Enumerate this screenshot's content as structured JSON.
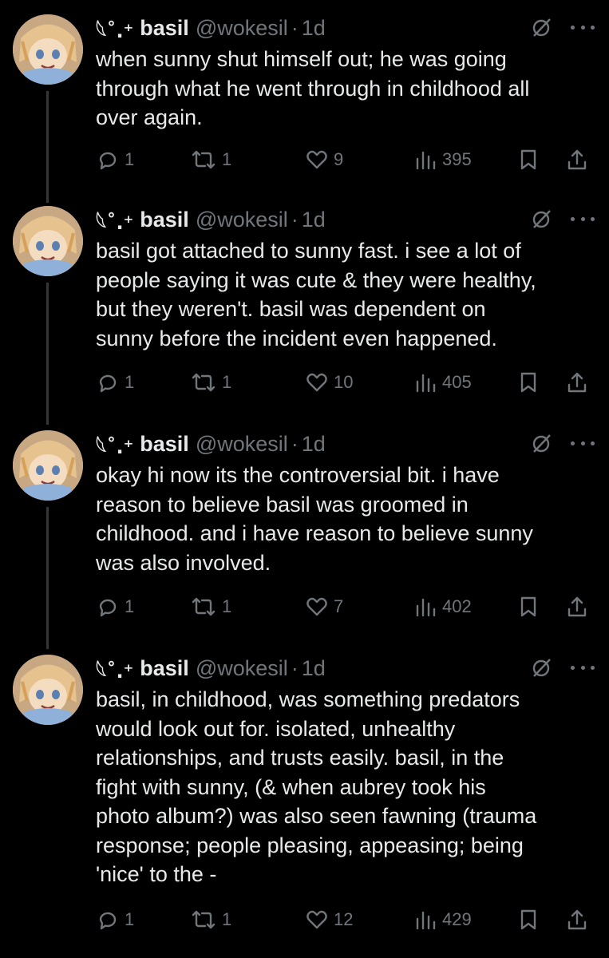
{
  "tweets": [
    {
      "deco": "𓆩˚.⁺",
      "name": "basil",
      "handle": "@wokesil",
      "dot": "·",
      "time": "1d",
      "text": "when sunny shut himself out; he was going\nthrough what he went through in childhood all\nover again.",
      "replies": "1",
      "retweets": "1",
      "likes": "9",
      "views": "395"
    },
    {
      "deco": "𓆩˚.⁺",
      "name": "basil",
      "handle": "@wokesil",
      "dot": "·",
      "time": "1d",
      "text": "basil got attached to sunny fast. i see a lot of\npeople saying it was cute & they were healthy,\nbut they weren't. basil was dependent on\nsunny before the incident even happened.",
      "replies": "1",
      "retweets": "1",
      "likes": "10",
      "views": "405"
    },
    {
      "deco": "𓆩˚.⁺",
      "name": "basil",
      "handle": "@wokesil",
      "dot": "·",
      "time": "1d",
      "text": "okay hi now its the controversial bit. i have\nreason to believe basil was groomed in\nchildhood. and i have reason to believe sunny\nwas also involved.",
      "replies": "1",
      "retweets": "1",
      "likes": "7",
      "views": "402"
    },
    {
      "deco": "𓆩˚.⁺",
      "name": "basil",
      "handle": "@wokesil",
      "dot": "·",
      "time": "1d",
      "text": "basil, in childhood, was something predators\nwould look out for. isolated, unhealthy\nrelationships, and trusts easily. basil, in the\nfight with sunny, (& when aubrey took his\nphoto album?) was also seen fawning (trauma\nresponse; people pleasing, appeasing; being\n'nice' to the -",
      "replies": "1",
      "retweets": "1",
      "likes": "12",
      "views": "429"
    }
  ],
  "colors": {
    "background": "#000000",
    "text": "#e7e9ea",
    "muted": "#71767b",
    "thread_line": "#333639"
  },
  "icons": [
    "reply-icon",
    "retweet-icon",
    "like-icon",
    "views-icon",
    "bookmark-icon",
    "share-icon",
    "grok-icon",
    "more-icon"
  ]
}
